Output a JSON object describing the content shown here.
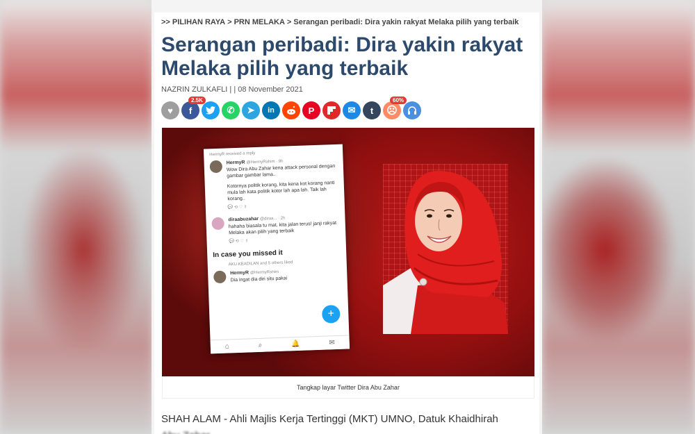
{
  "breadcrumb": {
    "prefix": ">>",
    "items": [
      "PILIHAN RAYA",
      "PRN MELAKA",
      "Serangan peribadi: Dira yakin rakyat Melaka pilih yang terbaik"
    ]
  },
  "article": {
    "title": "Serangan peribadi: Dira yakin rakyat Melaka pilih yang terbaik",
    "author": "NAZRIN ZULKAFLI",
    "date": "08 November 2021",
    "caption": "Tangkap layar Twitter Dira Abu Zahar",
    "body_line1": "SHAH ALAM - Ahli Majlis Kerja Tertinggi (MKT) UMNO, Datuk Khaidhirah",
    "body_line2": "Abu Zahar ..."
  },
  "share": {
    "facebook_count": "2.5K",
    "reaction_percent": "60%",
    "icons": [
      {
        "name": "like-icon",
        "color": "#9e9e9e",
        "glyph": "♥"
      },
      {
        "name": "facebook-icon",
        "color": "#3b5998",
        "glyph": "f"
      },
      {
        "name": "twitter-icon",
        "color": "#1da1f2",
        "glyph": "🐦"
      },
      {
        "name": "whatsapp-icon",
        "color": "#25d366",
        "glyph": "✆"
      },
      {
        "name": "telegram-icon",
        "color": "#2ca5e0",
        "glyph": "➤"
      },
      {
        "name": "linkedin-icon",
        "color": "#0077b5",
        "glyph": "in"
      },
      {
        "name": "reddit-icon",
        "color": "#ff4500",
        "glyph": "●"
      },
      {
        "name": "pinterest-icon",
        "color": "#e60023",
        "glyph": "P"
      },
      {
        "name": "flipboard-icon",
        "color": "#e12828",
        "glyph": "F"
      },
      {
        "name": "email-icon",
        "color": "#1e88e5",
        "glyph": "✉"
      },
      {
        "name": "tumblr-icon",
        "color": "#35465c",
        "glyph": "t"
      },
      {
        "name": "reaction-icon",
        "color": "#ff8a65",
        "glyph": "☹"
      },
      {
        "name": "listen-icon",
        "color": "#4a90e2",
        "glyph": "🎧"
      }
    ]
  },
  "tweet": {
    "header": "HermyR received a reply",
    "user1": "HermyR",
    "user1_handle": "@HermyRahim · 9h",
    "user1_text": "Wow Dira Abu Zahar kena attack personal dengan gambar gambar lama..",
    "user1_text2": "Kotornya politik korang, kita kena kot korang nanti mula lah kata politik kotor lah apa lah. Taik lah korang..",
    "user2": "diraabuzahar",
    "user2_handle": "@diraa... · 2h",
    "user2_text": "hahaha biasala tu mat, kita jalan terus! janji rakyat Melaka akan pilih yang terbaik",
    "missed": "In case you missed it",
    "liked_by": "AKU KEADILAN and 5 others liked",
    "user3": "HermyR",
    "user3_handle": "@HermyRahim",
    "user3_text": "Dia ingat dia diri situ pakai"
  }
}
